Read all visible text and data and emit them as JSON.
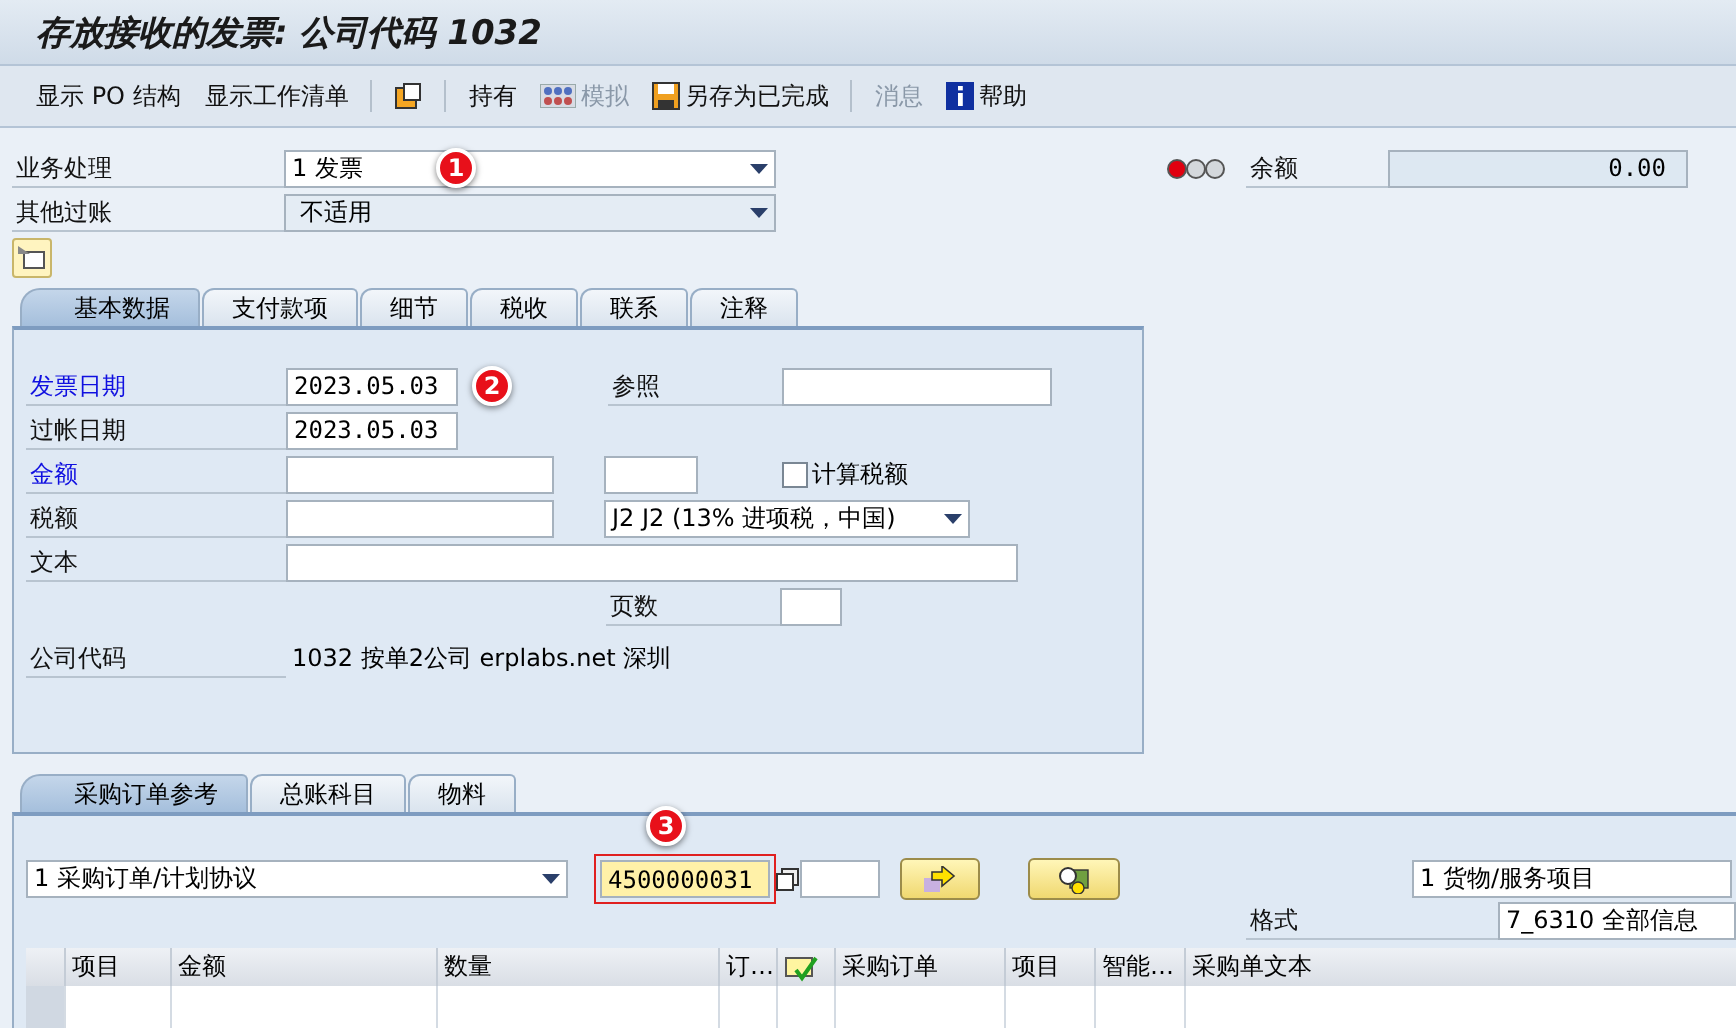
{
  "title": "存放接收的发票: 公司代码 1032",
  "toolbar": [
    {
      "kind": "button",
      "label": "显示 PO 结构",
      "disabled": false
    },
    {
      "kind": "button",
      "label": "显示工作清单",
      "disabled": false
    },
    {
      "kind": "separator"
    },
    {
      "kind": "layout"
    },
    {
      "kind": "separator"
    },
    {
      "kind": "button",
      "label": "持有",
      "disabled": false
    },
    {
      "kind": "simulate",
      "label": "模拟",
      "disabled": true
    },
    {
      "kind": "save",
      "label": "另存为已完成",
      "disabled": false
    },
    {
      "kind": "separator"
    },
    {
      "kind": "button",
      "label": "消息",
      "disabled": true
    },
    {
      "kind": "help",
      "label": "帮助",
      "disabled": false
    }
  ],
  "header": {
    "transaction": {
      "label": "业务处理",
      "value": "1 发票",
      "marker": "1"
    },
    "other_posting": {
      "label": "其他过账",
      "value": "不适用"
    },
    "balance": {
      "label": "余额",
      "value": "0.00",
      "alert": true
    }
  },
  "tabs": [
    {
      "label": "基本数据",
      "selected": true
    },
    {
      "label": "支付款项",
      "selected": false
    },
    {
      "label": "细节",
      "selected": false
    },
    {
      "label": "税收",
      "selected": false
    },
    {
      "label": "联系",
      "selected": false
    },
    {
      "label": "注释",
      "selected": false
    }
  ],
  "basic_data": {
    "invoice_date": {
      "label": "发票日期",
      "value": "2023.05.03",
      "required": true,
      "marker": "2"
    },
    "reference": {
      "label": "参照"
    },
    "posting_date": {
      "label": "过帐日期",
      "value": "2023.05.03",
      "required": false
    },
    "amount": {
      "label": "金额",
      "required": true
    },
    "calculate_tax": {
      "label": "计算税额",
      "checked": false
    },
    "tax_amount": {
      "label": "税额",
      "required": false
    },
    "tax_code": {
      "value": "J2 J2 (13% 进项税，中国)"
    },
    "text": {
      "label": "文本",
      "required": false
    },
    "pages": {
      "label": "页数"
    },
    "company_code": {
      "label": "公司代码",
      "value": "1032 按单2公司 erplabs.net 深圳"
    }
  },
  "lower_tabs": [
    {
      "label": "采购订单参考",
      "selected": true
    },
    {
      "label": "总账科目",
      "selected": false
    },
    {
      "label": "物料",
      "selected": false
    }
  ],
  "po_reference": {
    "doc_type": "1 采购订单/计划协议",
    "po_number": "4500000031",
    "po_focused": true,
    "marker": "3",
    "item_type": "1 货物/服务项目",
    "layout_label": "格式",
    "layout_value": "7_6310 全部信息"
  },
  "table": {
    "columns": [
      {
        "kind": "text",
        "label": "项目"
      },
      {
        "kind": "text",
        "label": "金额"
      },
      {
        "kind": "text",
        "label": "数量"
      },
      {
        "kind": "text",
        "label": "订…"
      },
      {
        "kind": "icon"
      },
      {
        "kind": "text",
        "label": "采购订单"
      },
      {
        "kind": "text",
        "label": "项目"
      },
      {
        "kind": "text",
        "label": "智能…"
      },
      {
        "kind": "text",
        "label": "采购单文本"
      }
    ]
  }
}
